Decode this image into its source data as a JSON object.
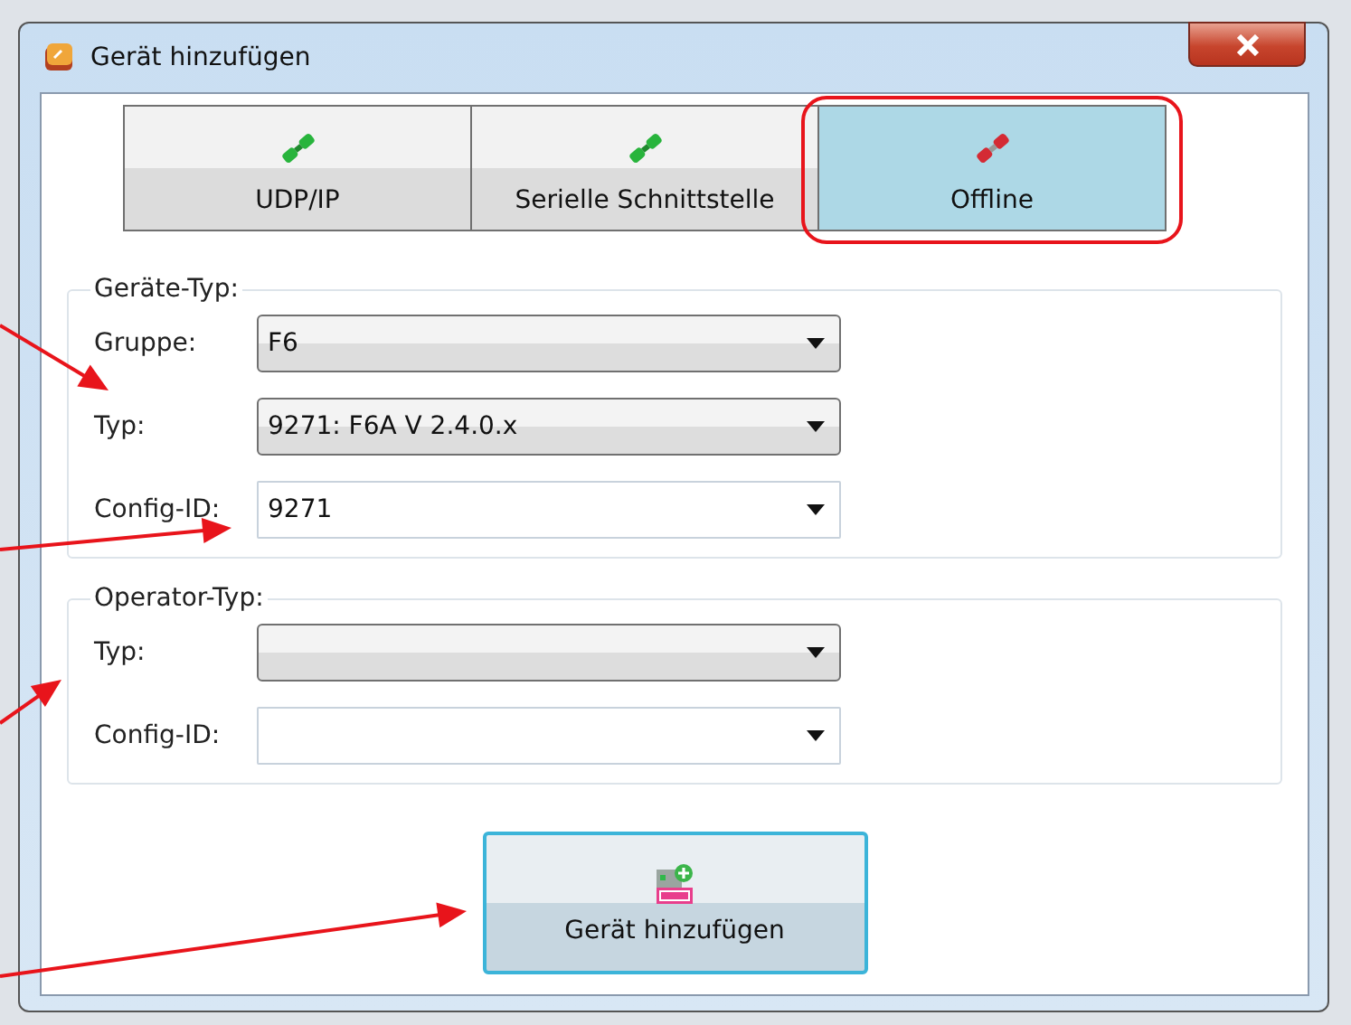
{
  "window": {
    "title": "Gerät hinzufügen"
  },
  "tabs": [
    {
      "label": "UDP/IP",
      "selected": false,
      "connected": true
    },
    {
      "label": "Serielle Schnittstelle",
      "selected": false,
      "connected": true
    },
    {
      "label": "Offline",
      "selected": true,
      "connected": false
    }
  ],
  "groups": [
    {
      "title": "Geräte-Typ:",
      "fields": [
        {
          "label": "Gruppe:",
          "kind": "combo",
          "value": "F6"
        },
        {
          "label": "Typ:",
          "kind": "combo",
          "value": "9271: F6A V 2.4.0.x"
        },
        {
          "label": "Config-ID:",
          "kind": "editable",
          "value": "9271"
        }
      ]
    },
    {
      "title": "Operator-Typ:",
      "fields": [
        {
          "label": "Typ:",
          "kind": "combo"
        },
        {
          "label": "Config-ID:",
          "kind": "editable"
        }
      ]
    }
  ],
  "add_button": {
    "label": "Gerät hinzufügen"
  }
}
